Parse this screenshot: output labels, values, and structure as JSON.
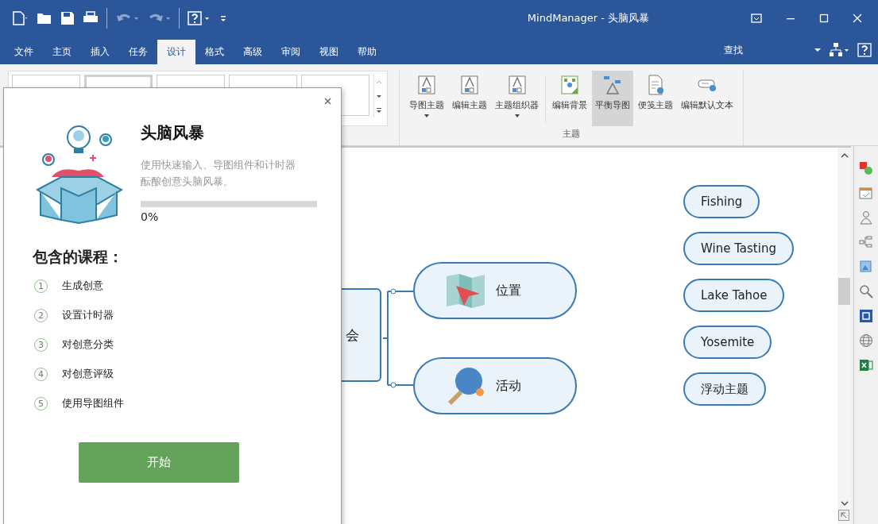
{
  "window": {
    "title": "MindManager - 头脑风暴"
  },
  "tabs": [
    {
      "label": "文件",
      "selected": false
    },
    {
      "label": "主页",
      "selected": false
    },
    {
      "label": "插入",
      "selected": false
    },
    {
      "label": "任务",
      "selected": false
    },
    {
      "label": "设计",
      "selected": true
    },
    {
      "label": "格式",
      "selected": false
    },
    {
      "label": "高级",
      "selected": false
    },
    {
      "label": "审阅",
      "selected": false
    },
    {
      "label": "视图",
      "selected": false
    },
    {
      "label": "帮助",
      "selected": false
    }
  ],
  "search_label": "查找",
  "ribbon": {
    "group_label": "主题",
    "buttons": [
      {
        "label": "导图主题",
        "has_menu": true,
        "selected": false
      },
      {
        "label": "编辑主题",
        "has_menu": false,
        "selected": false
      },
      {
        "label": "主题组织器",
        "has_menu": true,
        "selected": false
      },
      {
        "label": "编辑背景",
        "has_menu": false,
        "selected": false
      },
      {
        "label": "平衡导图",
        "has_menu": false,
        "selected": true
      },
      {
        "label": "便笺主题",
        "has_menu": false,
        "selected": false
      },
      {
        "label": "编辑默认文本",
        "has_menu": false,
        "selected": false
      }
    ]
  },
  "canvas": {
    "central_topic": "会",
    "topics": [
      {
        "label": "位置"
      },
      {
        "label": "活动"
      }
    ],
    "floating_topics": [
      "Fishing",
      "Wine Tasting",
      "Lake Tahoe",
      "Yosemite",
      "浮动主题"
    ]
  },
  "panel": {
    "title": "头脑风暴",
    "description": "使用快速输入、导图组件和计时器酝酿创意头脑风暴。",
    "progress": {
      "level": 0,
      "reading": "0%"
    },
    "section_heading": "包含的课程：",
    "lessons": [
      {
        "number": "1",
        "label": "生成创意"
      },
      {
        "number": "2",
        "label": "设置计时器"
      },
      {
        "number": "3",
        "label": "对创意分类"
      },
      {
        "number": "4",
        "label": "对创意评级"
      },
      {
        "number": "5",
        "label": "使用导图组件"
      }
    ],
    "start_button": "开始"
  }
}
